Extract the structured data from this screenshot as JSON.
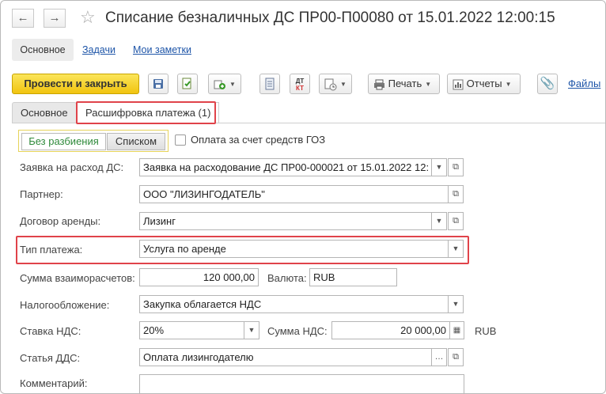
{
  "window": {
    "title": "Списание безналичных ДС ПР00-П00080 от 15.01.2022 12:00:15",
    "back_icon": "←",
    "forward_icon": "→",
    "star_icon": "☆"
  },
  "sections": {
    "main": "Основное",
    "tasks": "Задачи",
    "notes": "Мои заметки"
  },
  "toolbar": {
    "post_close": "Провести и закрыть",
    "dtkt": "Дт/Кт",
    "print": "Печать",
    "reports": "Отчеты",
    "files": "Файлы"
  },
  "tabs": {
    "main": "Основное",
    "decoding": "Расшифровка платежа (1)"
  },
  "switch": {
    "without_split": "Без разбиения",
    "list": "Списком"
  },
  "goz_checkbox": "Оплата за счет средств ГОЗ",
  "form": {
    "request": {
      "label": "Заявка на расход ДС:",
      "value": "Заявка на расходование ДС ПР00-000021 от 15.01.2022 12:"
    },
    "partner": {
      "label": "Партнер:",
      "value": "ООО \"ЛИЗИНГОДАТЕЛЬ\""
    },
    "contract": {
      "label": "Договор аренды:",
      "value": "Лизинг"
    },
    "payment_type": {
      "label": "Тип платежа:",
      "value": "Услуга по аренде"
    },
    "amount": {
      "label": "Сумма взаиморасчетов:",
      "value": "120 000,00"
    },
    "currency": {
      "label": "Валюта:",
      "value": "RUB"
    },
    "taxation": {
      "label": "Налогообложение:",
      "value": "Закупка облагается НДС"
    },
    "vat_rate": {
      "label": "Ставка НДС:",
      "value": "20%"
    },
    "vat_amount": {
      "label": "Сумма НДС:",
      "value": "20 000,00",
      "currency": "RUB"
    },
    "cashflow_item": {
      "label": "Статья ДДС:",
      "value": "Оплата лизингодателю"
    },
    "comment": {
      "label": "Комментарий:",
      "value": ""
    }
  },
  "colors": {
    "primary_button": "#f1c40f",
    "highlight_box": "#e0434a",
    "link": "#1e55a8",
    "switch_active_text": "#2f8a3a"
  }
}
